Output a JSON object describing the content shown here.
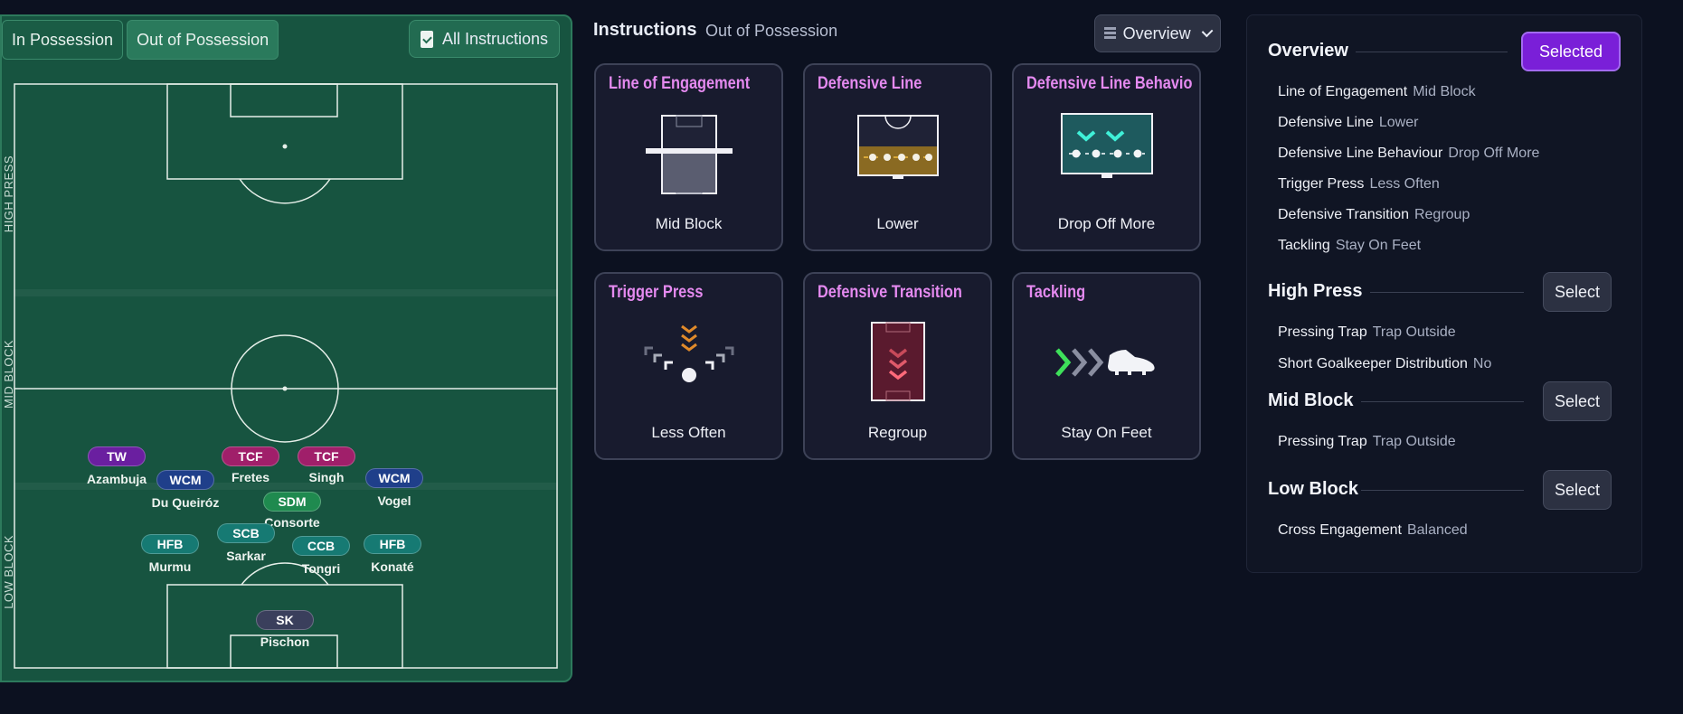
{
  "tabs": {
    "in_possession": "In Possession",
    "out_of_possession": "Out of Possession",
    "all_instructions": "All Instructions"
  },
  "zones": {
    "high": "HIGH PRESS",
    "mid": "MID BLOCK",
    "low": "LOW BLOCK"
  },
  "players": [
    {
      "role": "TW",
      "name": "Azambuja",
      "color": "#6a1fa0"
    },
    {
      "role": "WCM",
      "name": "Du Queiróz",
      "color": "#1f3f8a"
    },
    {
      "role": "TCF",
      "name": "Fretes",
      "color": "#a01f6a"
    },
    {
      "role": "TCF",
      "name": "Singh",
      "color": "#a01f6a"
    },
    {
      "role": "WCM",
      "name": "Vogel",
      "color": "#1f3f8a"
    },
    {
      "role": "SDM",
      "name": "Consorte",
      "color": "#1f8a4f"
    },
    {
      "role": "SCB",
      "name": "Sarkar",
      "color": "#167a73"
    },
    {
      "role": "HFB",
      "name": "Murmu",
      "color": "#167a73"
    },
    {
      "role": "CCB",
      "name": "Tongri",
      "color": "#167a73"
    },
    {
      "role": "HFB",
      "name": "Konaté",
      "color": "#167a73"
    },
    {
      "role": "SK",
      "name": "Pischon",
      "color": "#3a3f5c"
    }
  ],
  "instructions": {
    "title": "Instructions",
    "subtitle": "Out of Possession",
    "view_dropdown": "Overview",
    "cards": [
      {
        "title": "Line of Engagement",
        "value": "Mid Block",
        "icon": "line-of-engagement-icon"
      },
      {
        "title": "Defensive Line",
        "value": "Lower",
        "icon": "defensive-line-icon"
      },
      {
        "title": "Defensive Line Behavio",
        "value": "Drop Off More",
        "icon": "defensive-line-behaviour-icon"
      },
      {
        "title": "Trigger Press",
        "value": "Less Often",
        "icon": "trigger-press-icon"
      },
      {
        "title": "Defensive Transition",
        "value": "Regroup",
        "icon": "defensive-transition-icon"
      },
      {
        "title": "Tackling",
        "value": "Stay On Feet",
        "icon": "tackling-boot-icon"
      }
    ]
  },
  "overview": {
    "title": "Overview",
    "selected_label": "Selected",
    "rows": [
      {
        "k": "Line of Engagement",
        "v": "Mid Block"
      },
      {
        "k": "Defensive Line",
        "v": "Lower"
      },
      {
        "k": "Defensive Line Behaviour",
        "v": "Drop Off More"
      },
      {
        "k": "Trigger Press",
        "v": "Less Often"
      },
      {
        "k": "Defensive Transition",
        "v": "Regroup"
      },
      {
        "k": "Tackling",
        "v": "Stay On Feet"
      }
    ]
  },
  "high_press": {
    "title": "High Press",
    "select_label": "Select",
    "rows": [
      {
        "k": "Pressing Trap",
        "v": "Trap Outside"
      },
      {
        "k": "Short Goalkeeper Distribution",
        "v": "No"
      }
    ]
  },
  "mid_block": {
    "title": "Mid Block",
    "select_label": "Select",
    "rows": [
      {
        "k": "Pressing Trap",
        "v": "Trap Outside"
      }
    ]
  },
  "low_block": {
    "title": "Low Block",
    "select_label": "Select",
    "rows": [
      {
        "k": "Cross Engagement",
        "v": "Balanced"
      }
    ]
  },
  "colors": {
    "pitch": "#175440",
    "accent": "#7a1fd8",
    "card_title": "#e58af0"
  }
}
